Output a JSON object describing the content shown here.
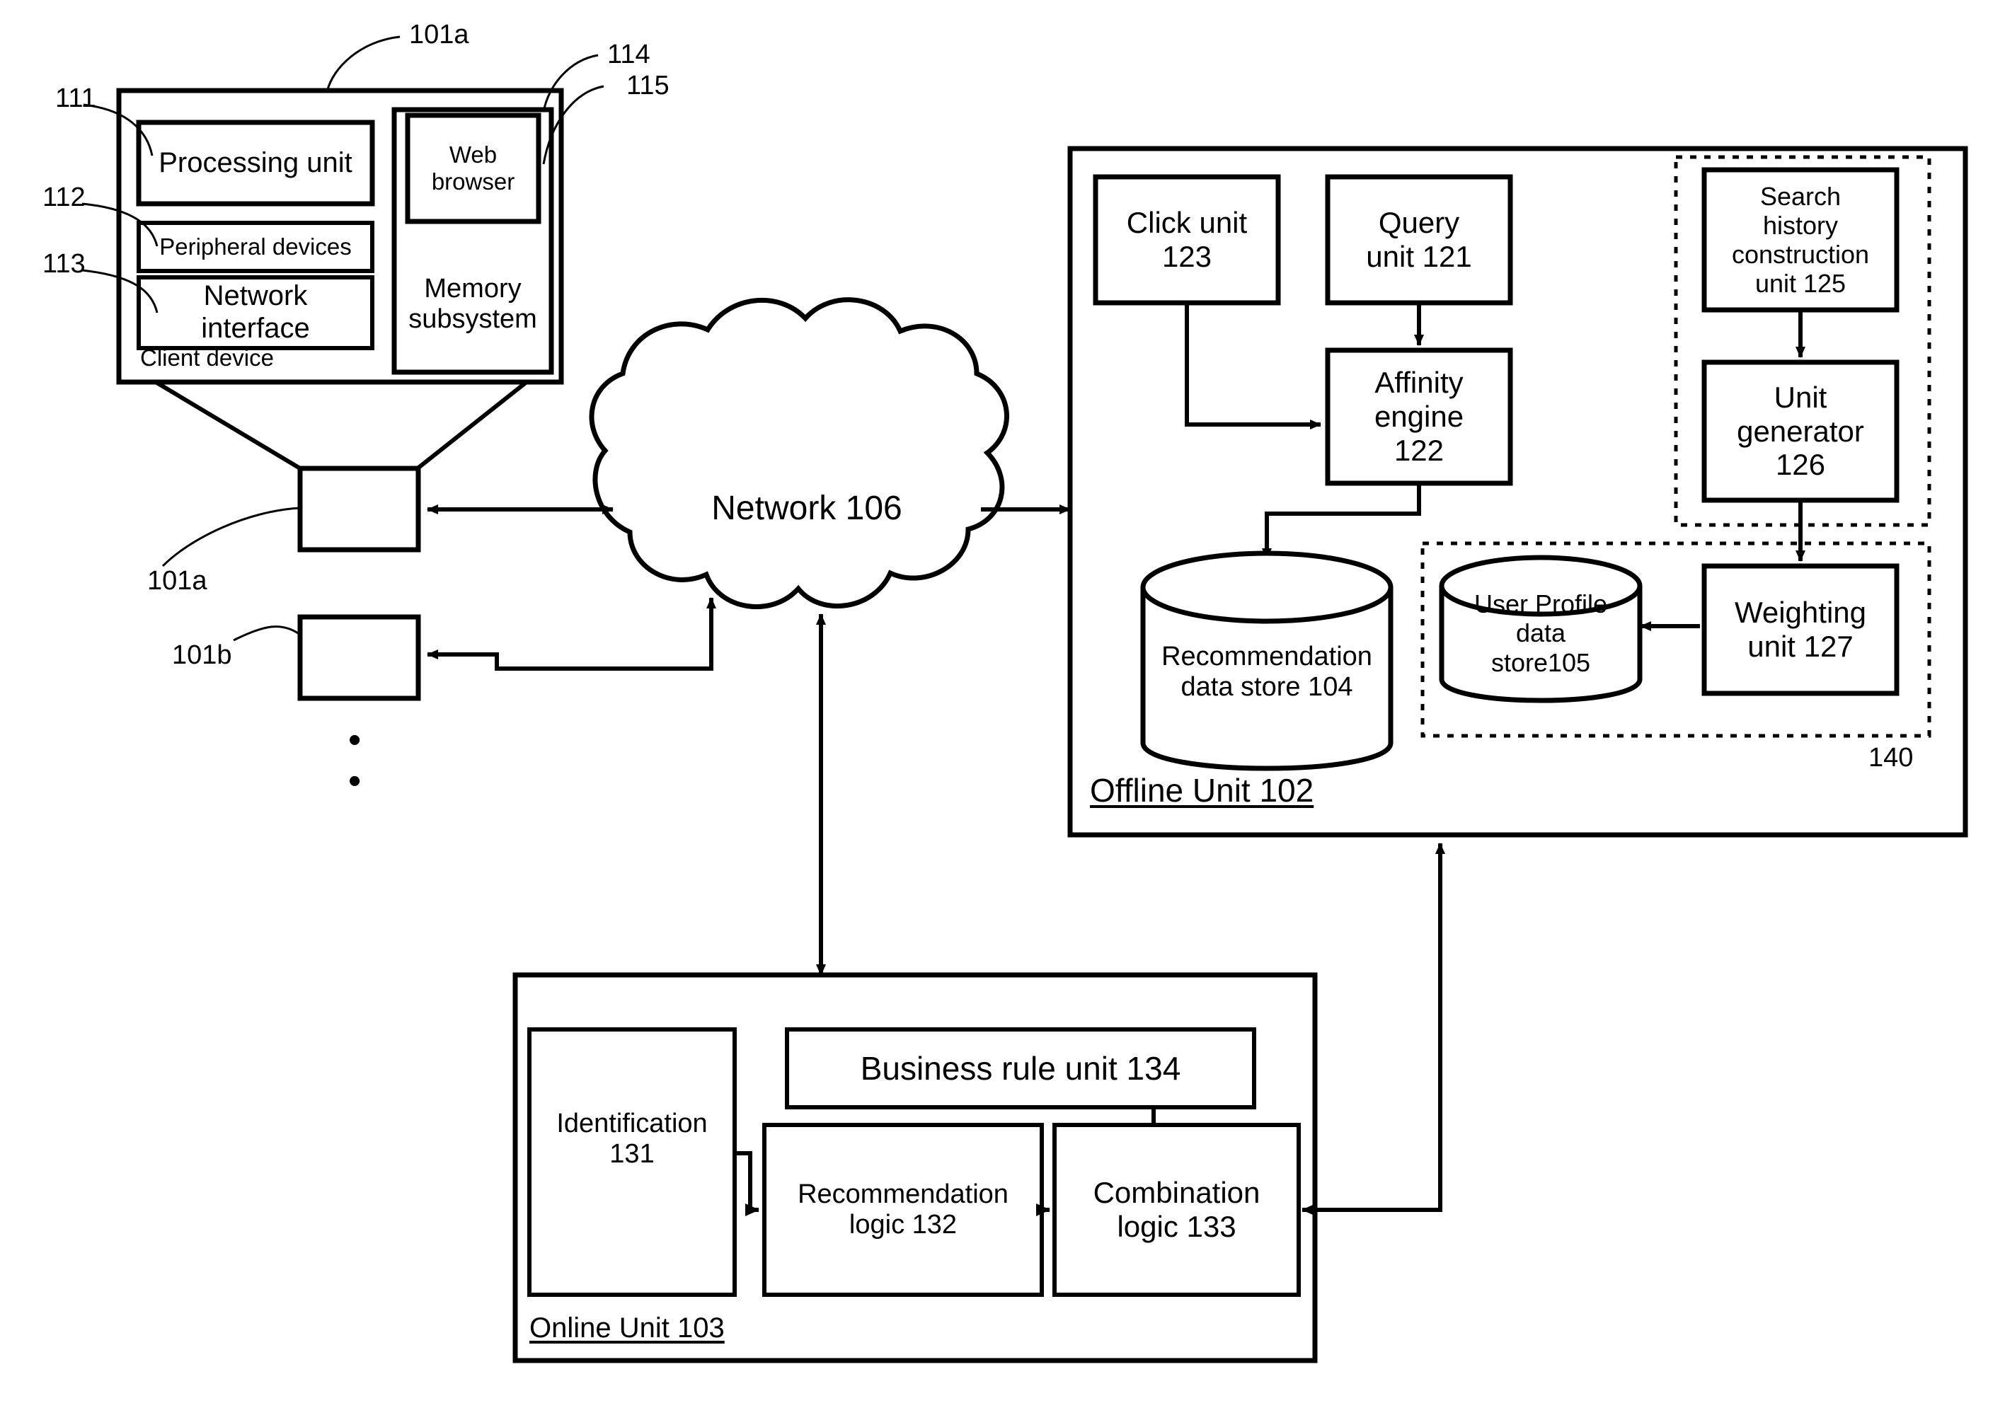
{
  "figure": {
    "type": "patent-system-block-diagram",
    "title": "Recommendation system architecture block diagram"
  },
  "client_device": {
    "container_label": "Client device",
    "ref_top": "101a",
    "blocks": [
      {
        "label": "Processing unit",
        "ref": "111"
      },
      {
        "label": "Peripheral devices",
        "ref": "112"
      },
      {
        "label": "Network\ninterface",
        "ref": "113"
      },
      {
        "label": "Web\nbrowser",
        "ref": "115"
      },
      {
        "label": "Memory\nsubsystem",
        "ref": "114"
      }
    ],
    "processing_unit": "Processing unit",
    "peripheral_devices": "Peripheral devices",
    "network_interface": "Network\ninterface",
    "web_browser": "Web\nbrowser",
    "memory_subsystem": "Memory\nsubsystem",
    "ref_111": "111",
    "ref_112": "112",
    "ref_113": "113",
    "ref_114": "114",
    "ref_115": "115"
  },
  "devices": {
    "device_a_ref": "101a",
    "device_b_ref": "101b",
    "ellipsis": "•"
  },
  "network": {
    "label": "Network 106"
  },
  "offline_unit": {
    "title": "Offline Unit 102",
    "group_ref": "140",
    "click_unit": "Click unit\n123",
    "query_unit": "Query\nunit 121",
    "affinity_engine": "Affinity\nengine\n122",
    "search_history_unit": "Search\nhistory\nconstruction\nunit 125",
    "unit_generator": "Unit\ngenerator\n126",
    "weighting_unit": "Weighting\nunit 127",
    "recommendation_store": "Recommendation\ndata store 104",
    "user_profile_store": "User Profile\ndata\nstore105"
  },
  "online_unit": {
    "title": "Online Unit 103",
    "identification": "Identification\n131",
    "business_rule_unit": "Business rule unit 134",
    "recommendation_logic": "Recommendation\nlogic 132",
    "combination_logic": "Combination\nlogic 133"
  },
  "colors": {
    "stroke": "#000000",
    "background": "#ffffff"
  }
}
